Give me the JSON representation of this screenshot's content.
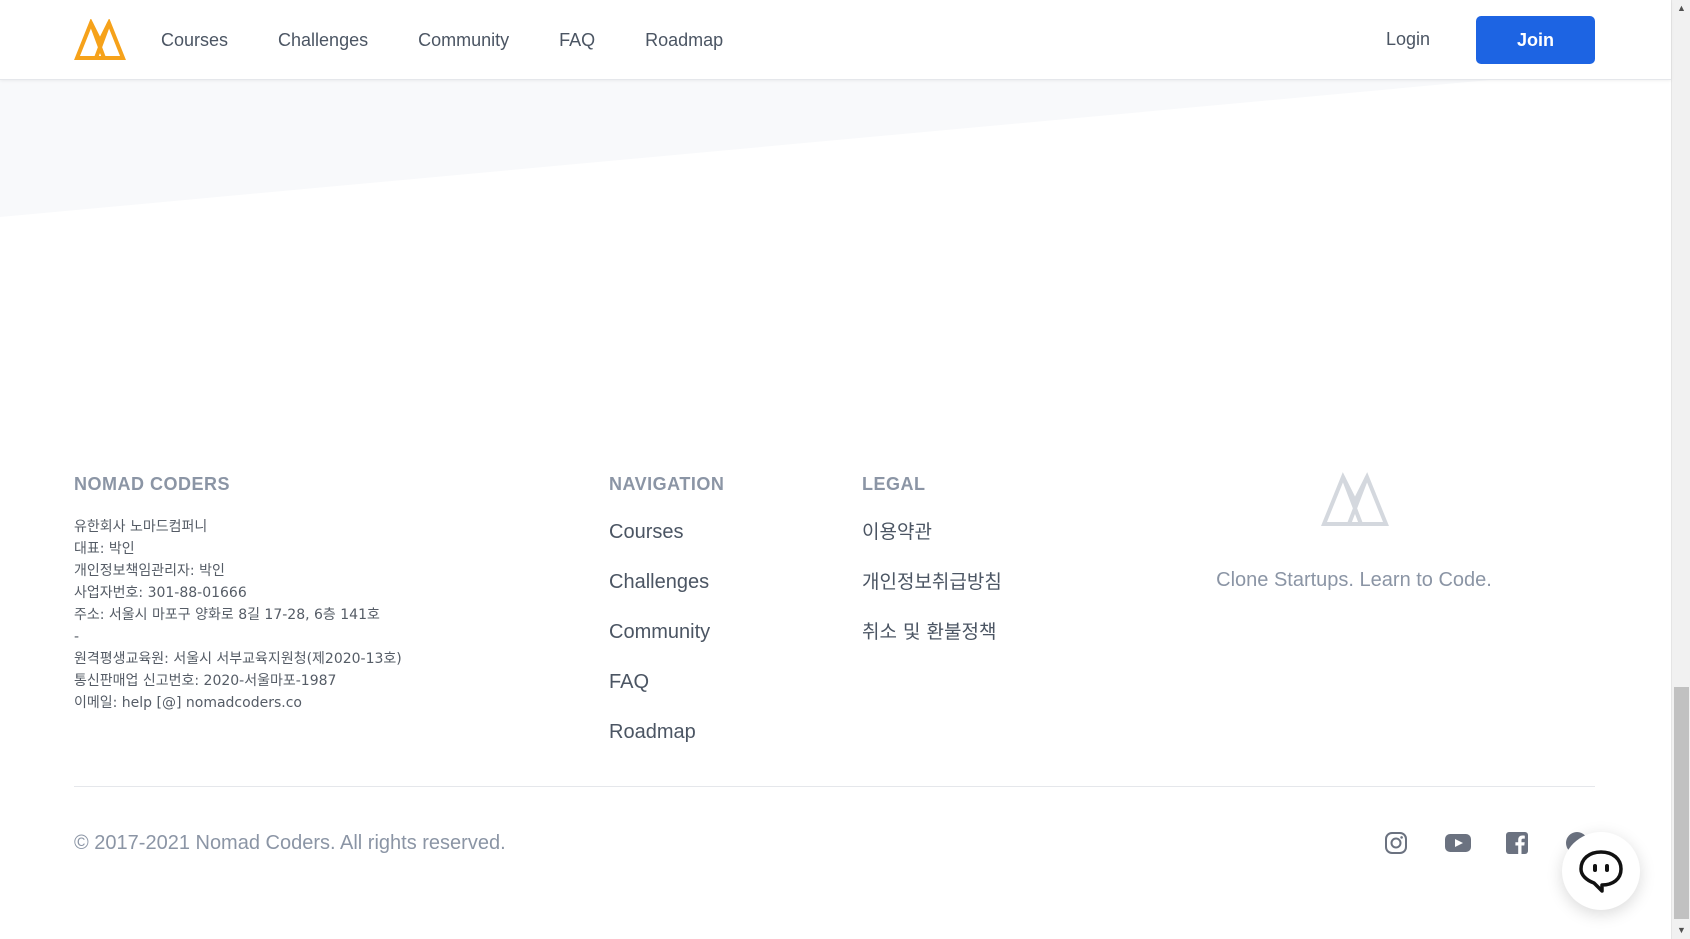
{
  "header": {
    "nav_items": [
      "Courses",
      "Challenges",
      "Community",
      "FAQ",
      "Roadmap"
    ],
    "login_label": "Login",
    "join_label": "Join"
  },
  "footer": {
    "company": {
      "title": "NOMAD CODERS",
      "lines": [
        "유한회사 노마드컴퍼니",
        "대표: 박인",
        "개인정보책임관리자: 박인",
        "사업자번호: 301-88-01666",
        "주소: 서울시 마포구 양화로 8길 17-28, 6층 141호",
        "-",
        "원격평생교육원: 서울시 서부교육지원청(제2020-13호)",
        "통신판매업 신고번호: 2020-서울마포-1987",
        "이메일: help [@] nomadcoders.co"
      ]
    },
    "navigation": {
      "title": "NAVIGATION",
      "items": [
        "Courses",
        "Challenges",
        "Community",
        "FAQ",
        "Roadmap"
      ]
    },
    "legal": {
      "title": "LEGAL",
      "items": [
        "이용약관",
        "개인정보취급방침",
        "취소 및 환불정책"
      ]
    },
    "tagline": "Clone Startups. Learn to Code.",
    "copyright": "© 2017-2021 Nomad Coders. All rights reserved.",
    "social_icons": [
      "instagram-icon",
      "youtube-icon",
      "facebook-icon",
      "github-icon"
    ]
  },
  "colors": {
    "brand_orange": "#f59e0b",
    "primary_blue": "#1d64e3",
    "muted_gray": "#8b95a5"
  }
}
